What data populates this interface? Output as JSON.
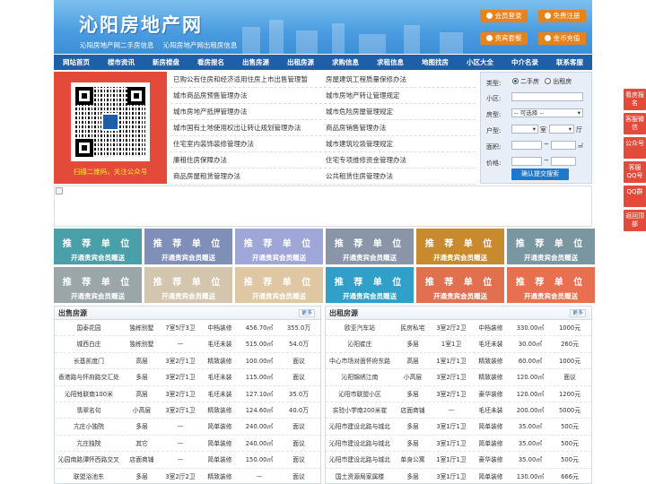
{
  "header": {
    "logo": "沁阳房地产网",
    "sublinks": [
      "沁阳房地产网二手房信息",
      "沁阳房地产网出租房信息"
    ],
    "buttons": [
      {
        "label": "会员登录",
        "icon": "user-icon"
      },
      {
        "label": "免费注册",
        "icon": "register-icon"
      },
      {
        "label": "贵宾套餐",
        "icon": "vip-icon"
      },
      {
        "label": "金币充值",
        "icon": "coin-icon"
      }
    ]
  },
  "nav": [
    "网站首页",
    "楼市资讯",
    "新房楼盘",
    "看房报名",
    "出售房源",
    "出租房源",
    "求购信息",
    "求租信息",
    "地图找房",
    "小区大全",
    "中介名录",
    "联系客服"
  ],
  "qr": {
    "caption": "扫描二维码，关注公众号"
  },
  "links": [
    [
      "已购公有住房和经济适用住房上市出售管理暂",
      "房屋建筑工程质量保修办法"
    ],
    [
      "城市商品房预售管理办法",
      "城市房地产转让管理规定"
    ],
    [
      "城市房地产抵押管理办法",
      "城市危险房屋管理规定"
    ],
    [
      "城市国有土地使用权出让转让规划管理办法",
      "商品房销售管理办法"
    ],
    [
      "住宅室内装饰装修管理办法",
      "城市建筑垃圾管理规定"
    ],
    [
      "廉租住房保障办法",
      "住宅专项维修资金管理办法"
    ],
    [
      "商品房屋租赁管理办法",
      "公共租赁住房管理办法"
    ]
  ],
  "search": {
    "type_label": "类型:",
    "radio_sale": "二手房",
    "radio_rent": "出租房",
    "community_label": "小区:",
    "house_label": "房型:",
    "house_select": "-- 可选择 --",
    "layout_label": "户型:",
    "room_unit": "室",
    "hall_unit": "厅",
    "area_label": "面积:",
    "price_label": "价格:",
    "range_sep": "~",
    "submit": "确认提交搜索"
  },
  "tiles": {
    "title": "推 荐 单 位",
    "subtitle": "开通贵宾会员赠送",
    "colors": [
      "#4aa0a8",
      "#7f8fb8",
      "#9fa6d8",
      "#8a96a8",
      "#c88a2c",
      "#7a96a0",
      "#9aa6a8",
      "#d4c6ae",
      "#e0c7a4",
      "#30a0c8",
      "#e07050",
      "#e87050"
    ]
  },
  "sale": {
    "title": "出售房源",
    "more": "更多",
    "rows": [
      [
        "国泰花园",
        "独栋别墅",
        "7室5厅3卫",
        "中档装修",
        "456.70㎡",
        "355.0万"
      ],
      [
        "城西白庄",
        "独栋别墅",
        "—",
        "毛坯未装",
        "515.00㎡",
        "54.0万"
      ],
      [
        "长基凯度门",
        "高层",
        "3室2厅1卫",
        "精致装修",
        "100.00㎡",
        "面议"
      ],
      [
        "香港路与怀府路交汇处",
        "多层",
        "3室2厅1卫",
        "毛坯未装",
        "115.00㎡",
        "面议"
      ],
      [
        "沁阳甡联南100米",
        "高层",
        "3室2厅1卫",
        "毛坯未装",
        "127.10㎡",
        "35.0万"
      ],
      [
        "翡翠名句",
        "小高层",
        "3室2厅1卫",
        "精致装修",
        "124.60㎡",
        "40.0万"
      ],
      [
        "亢庄小独院",
        "多层",
        "—",
        "简单装修",
        "240.00㎡",
        "面议"
      ],
      [
        "亢庄独院",
        "其它",
        "—",
        "简单装修",
        "240.00㎡",
        "面议"
      ],
      [
        "沁园南路谭怀西路交叉",
        "店面商铺",
        "—",
        "简单装修",
        "150.00㎡",
        "面议"
      ],
      [
        "联盟浴池东",
        "多层",
        "3室2厅2卫",
        "精致装修",
        "—",
        "面议"
      ]
    ]
  },
  "rent": {
    "title": "出租房源",
    "more": "更多",
    "rows": [
      [
        "欧亚汽车站",
        "民房私宅",
        "3室2厅2卫",
        "中档装修",
        "330.00㎡",
        "1000元"
      ],
      [
        "沁阳崔庄",
        "多层",
        "1室1卫",
        "毛坯未装",
        "30.00㎡",
        "260元"
      ],
      [
        "中心市场对面怀府东路",
        "高层",
        "1室1厅1卫",
        "精致装修",
        "60.00㎡",
        "1000元"
      ],
      [
        "沁阳锦绣江南",
        "小高层",
        "3室2厅1卫",
        "精致装修",
        "120.00㎡",
        "面议"
      ],
      [
        "沁阳市联盟小区",
        "多层",
        "3室2厅1卫",
        "豪华装修",
        "120.00㎡",
        "1200元"
      ],
      [
        "实验小学南200米崔",
        "店面商铺",
        "—",
        "毛坯未装",
        "200.00㎡",
        "5000元"
      ],
      [
        "沁阳市建设北路与城北",
        "多层",
        "3室1厅1卫",
        "简单装修",
        "35.00㎡",
        "500元"
      ],
      [
        "沁阳市建设北路与城北",
        "多层",
        "3室1厅1卫",
        "简单装修",
        "35.00㎡",
        "500元"
      ],
      [
        "沁阳市建设北路与城北",
        "单身公寓",
        "1室1厅1卫",
        "豪华装修",
        "35.00㎡",
        "500元"
      ],
      [
        "国土资源局家属楼",
        "多层",
        "3室1厅1卫",
        "简单装修",
        "130.00㎡",
        "666元"
      ]
    ]
  },
  "side": [
    "看房报名",
    "客服微信",
    "公众号",
    "客服QQ号",
    "QQ群",
    "返回顶部"
  ]
}
